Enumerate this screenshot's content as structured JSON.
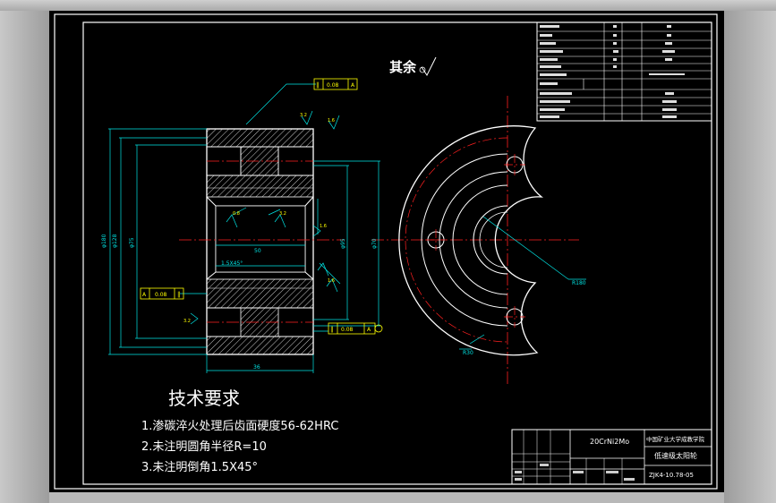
{
  "colors": {
    "background": "#000000",
    "outline": "#ffffff",
    "centerline": "#ff2020",
    "dimension": "#00e5e5",
    "hatch": "#ffffff",
    "datum_box": "#ffff00",
    "leader": "#00e5e5"
  },
  "drawing": {
    "surface_note": "其余",
    "roughness_marks": [
      "3.2",
      "1.6",
      "0.8",
      "3.2",
      "1.6",
      "3.2",
      "1.6"
    ],
    "datum_label": "A",
    "tolerance_frames": [
      {
        "symbol": "∥",
        "value": "0.08",
        "datum": "A"
      },
      {
        "symbol": "∥",
        "value": "0.08",
        "datum": "A"
      },
      {
        "symbol": "∥",
        "value": "0.08",
        "datum": "A"
      }
    ],
    "dimension_labels": [
      "φ180",
      "φ128",
      "φ75",
      "φ95",
      "φ70",
      "50",
      "36",
      "1.5X45°",
      "R180",
      "R30"
    ]
  },
  "technical_requirements": {
    "heading": "技术要求",
    "items": [
      "1.渗碳淬火处理后齿面硬度56-62HRC",
      "2.未注明圆角半径R=10",
      "3.未注明倒角1.5X45°"
    ]
  },
  "title_block": {
    "material": "20CrNi2Mo",
    "school": "中国矿业大学成教学院",
    "part_name": "低速级太阳轮",
    "drawing_number": "ZJK4-10.78-05"
  }
}
